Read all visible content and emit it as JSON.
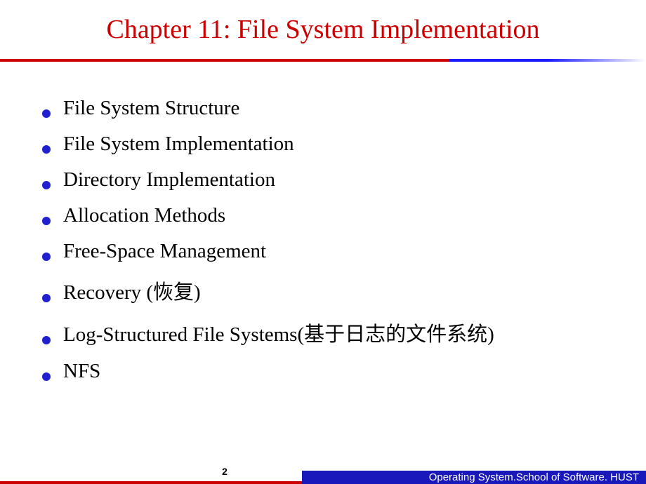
{
  "title": "Chapter 11: File System Implementation",
  "bullets": [
    "File System Structure",
    "File System Implementation",
    "Directory Implementation",
    "Allocation Methods",
    "Free-Space Management",
    "Recovery (恢复)",
    "Log-Structured File Systems(基于日志的文件系统)",
    "NFS"
  ],
  "pageNumber": "2",
  "footerText": "Operating System.School of Software. HUST"
}
